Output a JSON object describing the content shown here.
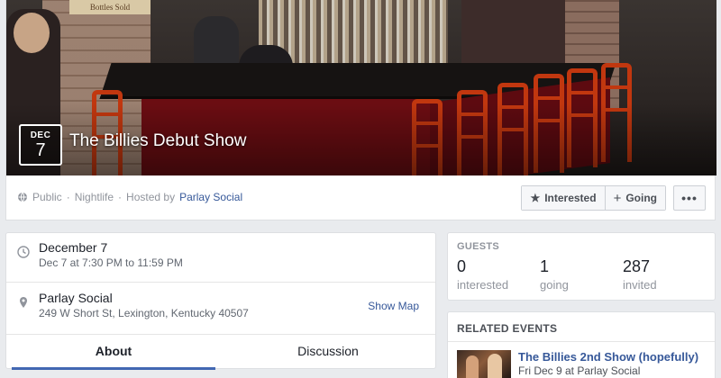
{
  "event": {
    "date_month": "DEC",
    "date_day": "7",
    "title": "The Billies Debut Show",
    "cover_sign": "Bottles Sold"
  },
  "meta": {
    "privacy": "Public",
    "separator1": "·",
    "category": "Nightlife",
    "separator2": "·",
    "hosted_prefix": "Hosted by",
    "host": "Parlay Social"
  },
  "actions": {
    "interested_label": "Interested",
    "going_label": "Going",
    "more_label": "•••"
  },
  "details": {
    "date_main": "December 7",
    "date_sub": "Dec 7 at 7:30 PM to 11:59 PM",
    "venue_main": "Parlay Social",
    "venue_sub": "249 W Short St, Lexington, Kentucky 40507",
    "show_map": "Show Map"
  },
  "tabs": [
    {
      "label": "About",
      "active": true
    },
    {
      "label": "Discussion",
      "active": false
    }
  ],
  "guests": {
    "heading": "GUESTS",
    "stats": [
      {
        "num": "0",
        "label": "interested"
      },
      {
        "num": "1",
        "label": "going"
      },
      {
        "num": "287",
        "label": "invited"
      }
    ]
  },
  "related": {
    "heading": "RELATED EVENTS",
    "items": [
      {
        "title": "The Billies 2nd Show (hopefully)",
        "sub": "Fri Dec 9 at Parlay Social"
      }
    ]
  },
  "colors": {
    "link": "#365899",
    "accent": "#4267b2",
    "background": "#e9ebee"
  }
}
